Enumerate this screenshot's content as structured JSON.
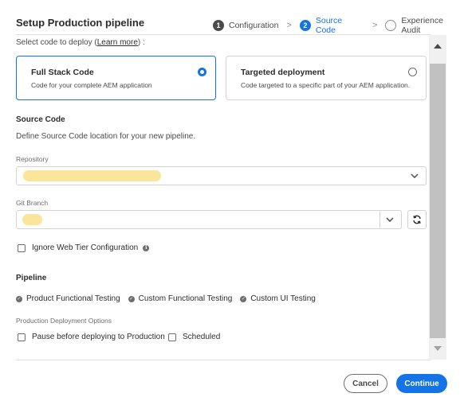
{
  "header": {
    "title": "Setup Production pipeline",
    "steps": [
      {
        "number": "1",
        "label": "Configuration",
        "state": "done"
      },
      {
        "number": "2",
        "label": "Source Code",
        "state": "active"
      },
      {
        "number": "",
        "label": "Experience Audit",
        "state": "todo"
      }
    ],
    "separator": ">"
  },
  "select_code": {
    "prefix": "Select code to deploy",
    "open_paren": "(",
    "link": "Learn more",
    "suffix": ") :"
  },
  "deploy_options": [
    {
      "title": "Full Stack Code",
      "description": "Code for your complete AEM application",
      "selected": true
    },
    {
      "title": "Targeted deployment",
      "description": "Code targeted to a specific part of your AEM application.",
      "selected": false
    }
  ],
  "source_code": {
    "title": "Source Code",
    "description": "Define Source Code location for your new pipeline.",
    "repository_label": "Repository",
    "branch_label": "Git Branch"
  },
  "ignore_web_tier": {
    "label": "Ignore Web Tier Configuration",
    "checked": false
  },
  "pipeline": {
    "title": "Pipeline",
    "tests": [
      "Product Functional Testing",
      "Custom Functional Testing",
      "Custom UI Testing"
    ],
    "deployment_options_label": "Production Deployment Options",
    "options": [
      {
        "label": "Pause before deploying to Production",
        "checked": false
      },
      {
        "label": "Scheduled",
        "checked": false
      }
    ]
  },
  "footer": {
    "cancel_label": "Cancel",
    "continue_label": "Continue"
  },
  "colors": {
    "accent": "#1473e6",
    "redaction": "#fbe59a"
  }
}
